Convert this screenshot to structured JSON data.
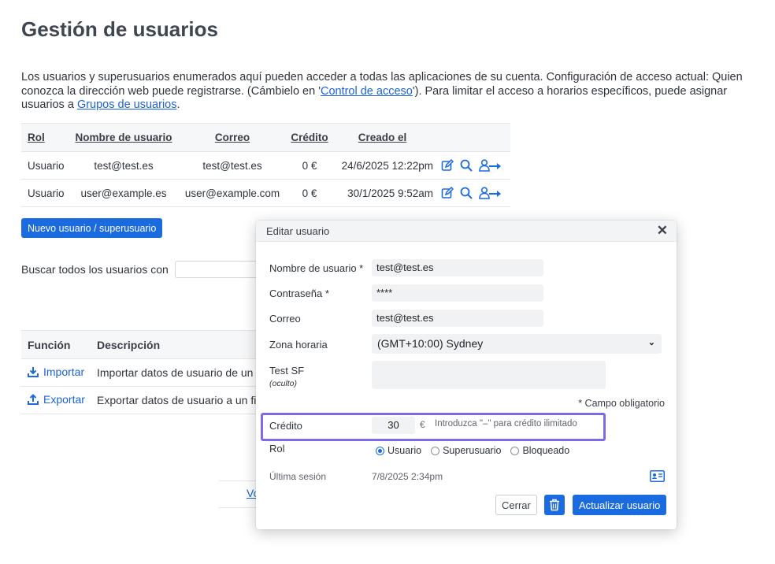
{
  "page": {
    "title": "Gestión de usuarios",
    "intro_part1": "Los usuarios y superusuarios enumerados aquí pueden acceder a todas las aplicaciones de su cuenta. Configuración de acceso actual: Quien conozca la dirección web puede registrarse. (Cámbielo en '",
    "intro_link1": "Control de acceso",
    "intro_part2": "'). Para limitar el acceso a horarios específicos, puede asignar usuarios a ",
    "intro_link2": "Grupos de usuarios",
    "intro_part3": "."
  },
  "users_table": {
    "headers": [
      "Rol",
      "Nombre de usuario",
      "Correo",
      "Crédito",
      "Creado el"
    ],
    "rows": [
      {
        "rol": "Usuario",
        "user": "test@test.es",
        "mail": "test@test.es",
        "credit": "0 €",
        "created": "24/6/2025 12:22pm"
      },
      {
        "rol": "Usuario",
        "user": "user@example.es",
        "mail": "user@example.com",
        "credit": "0 €",
        "created": "30/1/2025 9:52am"
      }
    ]
  },
  "new_user_button": "Nuevo usuario / superusuario",
  "search": {
    "label": "Buscar todos los usuarios con",
    "value": ""
  },
  "functions_table": {
    "headers": [
      "Función",
      "Descripción"
    ],
    "rows": [
      {
        "name": "Importar",
        "desc": "Importar datos de usuario de un fi"
      },
      {
        "name": "Exportar",
        "desc": "Exportar datos de usuario a un fic"
      }
    ]
  },
  "background_link": "Vo",
  "modal": {
    "title": "Editar usuario",
    "close": "✕",
    "fields": {
      "username_label": "Nombre de usuario *",
      "username_value": "test@test.es",
      "password_label": "Contraseña *",
      "password_value": "****",
      "email_label": "Correo",
      "email_value": "test@test.es",
      "timezone_label": "Zona horaria",
      "timezone_value": "(GMT+10:00) Sydney",
      "testsf_label": "Test SF",
      "testsf_sub": "(oculto)",
      "required_note": "* Campo obligatorio",
      "credit_label": "Crédito",
      "credit_value": "30",
      "credit_unit": "€",
      "credit_hint": "Introduzca \"–\" para crédito ilimitado",
      "role_label": "Rol",
      "role_options": [
        "Usuario",
        "Superusuario",
        "Bloqueado"
      ],
      "role_selected": "Usuario",
      "last_session_label": "Última sesión",
      "last_session_value": "7/8/2025 2:34pm"
    },
    "buttons": {
      "close": "Cerrar",
      "update": "Actualizar usuario"
    }
  },
  "colors": {
    "accent": "#1a6ae0",
    "link": "#1a63d8",
    "highlight": "#7b6be6"
  }
}
